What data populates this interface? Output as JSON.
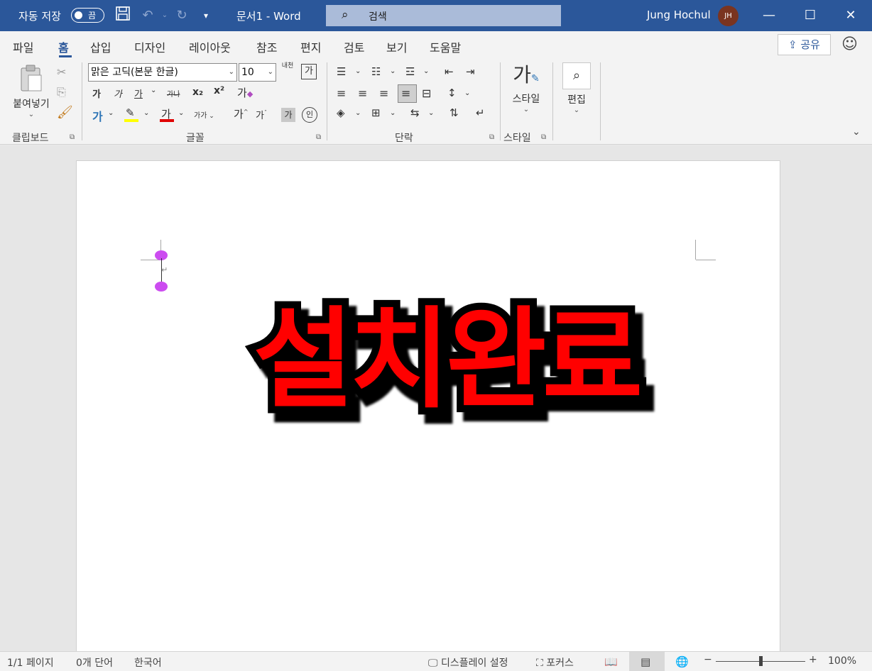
{
  "titlebar": {
    "autosave_label": "자동 저장",
    "autosave_state": "끔",
    "doc_title": "문서1  -  Word",
    "search_placeholder": "검색",
    "user_name": "Jung Hochul",
    "user_initials": "JH",
    "colors": {
      "background": "#2b579a",
      "search": "#aabbd9",
      "avatar": "#7a3420"
    }
  },
  "ribbon": {
    "tabs": [
      "파일",
      "홈",
      "삽입",
      "디자인",
      "레이아웃",
      "참조",
      "편지",
      "검토",
      "보기",
      "도움말"
    ],
    "active_tab": "홈",
    "share_label": "공유",
    "clipboard": {
      "paste_label": "붙여넣기",
      "group_label": "클립보드"
    },
    "font": {
      "font_name": "맑은 고딕(본문 한글)",
      "font_size": "10",
      "group_label": "글꼴",
      "bold": "가",
      "italic": "가",
      "underline": "가",
      "strikethrough": "가나",
      "subscript": "x₂",
      "superscript": "x²",
      "clear_format": "가",
      "text_effect": "가",
      "font_color": "가",
      "change_case": "가가",
      "grow": "가",
      "shrink": "가",
      "char_shade": "가",
      "enclose": "인",
      "phonetic": "내천",
      "char_border": "가"
    },
    "paragraph": {
      "group_label": "단락"
    },
    "styles": {
      "label": "스타일",
      "group_label": "스타일",
      "glyph": "가"
    },
    "editing": {
      "label": "편집"
    }
  },
  "document": {
    "text": "설치완료",
    "text_color": "#ff0000",
    "outline_color": "#000000"
  },
  "statusbar": {
    "page": "1/1 페이지",
    "words": "0개 단어",
    "language": "한국어",
    "display_settings": "디스플레이 설정",
    "focus": "포커스",
    "zoom": "100%"
  }
}
